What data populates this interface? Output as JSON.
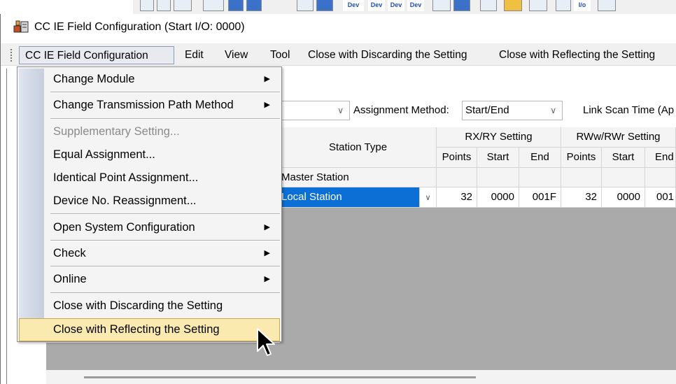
{
  "window": {
    "title": "CC IE Field Configuration (Start I/O: 0000)"
  },
  "toolbar": {
    "dev_labels": [
      "Dev",
      "Dev",
      "Dev",
      "Dev"
    ],
    "io_label": "I/o"
  },
  "menubar": {
    "items": [
      {
        "label": "CC IE Field Configuration"
      },
      {
        "label": "Edit"
      },
      {
        "label": "View"
      },
      {
        "label": "Tool"
      },
      {
        "label": "Close with Discarding the Setting"
      },
      {
        "label": "Close with Reflecting the Setting"
      }
    ]
  },
  "settings": {
    "assignment_label": "Assignment Method:",
    "assignment_value": "Start/End",
    "scan_time_label": "Link Scan Time (Ap"
  },
  "grid": {
    "station_type_header": "Station Type",
    "rxry_header": "RX/RY Setting",
    "rwwrwr_header": "RWw/RWr Setting",
    "subheaders": [
      "Points",
      "Start",
      "End",
      "Points",
      "Start",
      "End"
    ],
    "rows": [
      {
        "station_type": "Master Station",
        "cells": [
          "",
          "",
          "",
          "",
          "",
          ""
        ]
      },
      {
        "station_type": "Local Station",
        "cells": [
          "32",
          "0000",
          "001F",
          "32",
          "0000",
          "001"
        ]
      }
    ]
  },
  "dropdown": {
    "items": [
      {
        "label": "Change Module"
      },
      {
        "label": "Change Transmission Path Method"
      },
      {
        "label": "Supplementary Setting..."
      },
      {
        "label": "Equal Assignment..."
      },
      {
        "label": "Identical Point Assignment..."
      },
      {
        "label": "Device No. Reassignment..."
      },
      {
        "label": "Open System Configuration"
      },
      {
        "label": "Check"
      },
      {
        "label": "Online"
      },
      {
        "label": "Close with Discarding the Setting"
      },
      {
        "label": "Close with Reflecting the Setting"
      }
    ]
  }
}
